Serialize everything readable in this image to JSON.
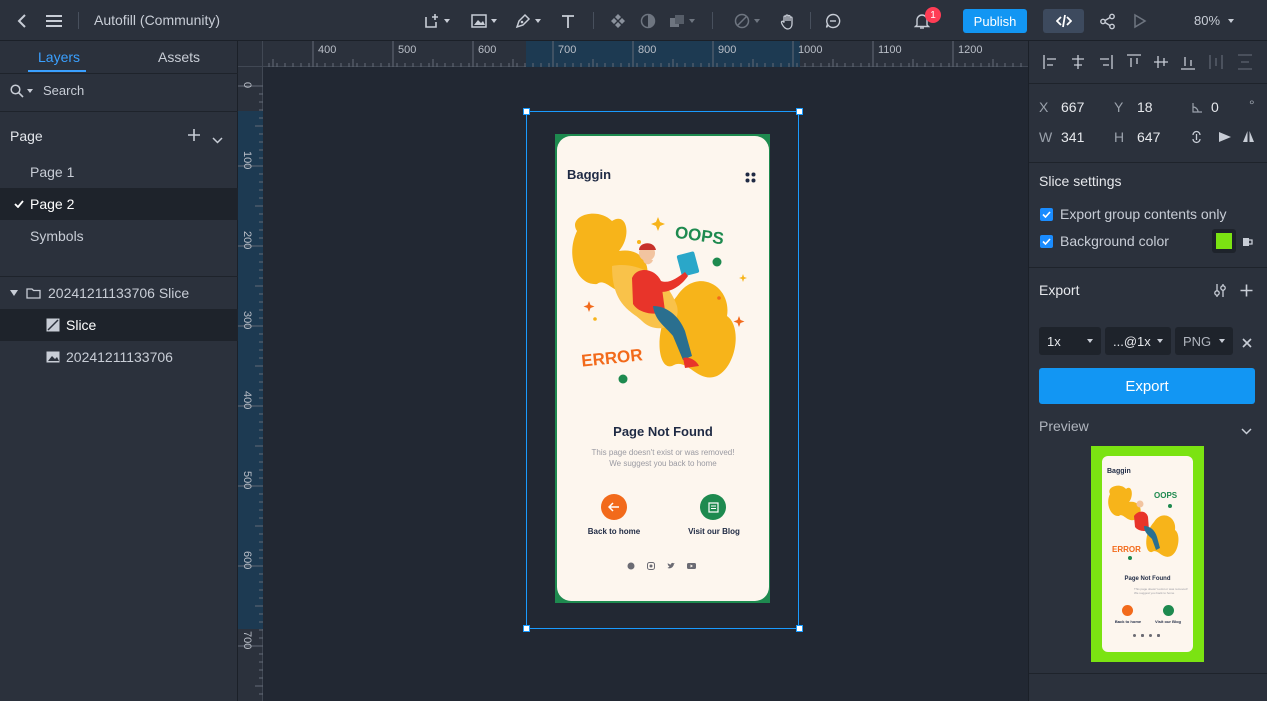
{
  "topbar": {
    "title": "Autofill (Community)",
    "publish_label": "Publish",
    "notification_count": "1",
    "zoom": "80%"
  },
  "left_panel": {
    "tabs": [
      "Layers",
      "Assets"
    ],
    "search_label": "Search",
    "page_header": "Page",
    "pages": [
      "Page 1",
      "Page 2",
      "Symbols"
    ],
    "layers": {
      "group": "20241211133706 Slice",
      "slice": "Slice",
      "image": "20241211133706"
    }
  },
  "rulers": {
    "horizontal": [
      "400",
      "500",
      "600",
      "700",
      "800",
      "900",
      "1000",
      "1100",
      "1200"
    ],
    "vertical": [
      "0",
      "100",
      "200",
      "300",
      "400",
      "500",
      "600",
      "700"
    ]
  },
  "phone": {
    "brand": "Baggin",
    "oops": "OOPS",
    "error": "ERROR",
    "heading": "Page Not Found",
    "subtext1": "This page doesn't exist or was removed!",
    "subtext2": "We suggest you back to home",
    "btn1": "Back to home",
    "btn2": "Visit our Blog",
    "social_icons": [
      "facebook-icon",
      "instagram-icon",
      "twitter-icon",
      "youtube-icon"
    ]
  },
  "right_panel": {
    "x_label": "X",
    "x_value": "667",
    "y_label": "Y",
    "y_value": "18",
    "rotation": "0",
    "degree": "°",
    "w_label": "W",
    "w_value": "341",
    "h_label": "H",
    "h_value": "647",
    "slice_settings": "Slice settings",
    "opt_export_group": "Export group contents only",
    "opt_bg_color": "Background color",
    "bg_color": "#7be312",
    "export_header": "Export",
    "scale": "1x",
    "suffix": "...@1x",
    "format": "PNG",
    "export_btn": "Export",
    "preview_label": "Preview"
  },
  "colors": {
    "accent": "#1296f3",
    "orange": "#f26a1b",
    "green": "#1e8a4f",
    "yellow": "#f7b41a"
  }
}
